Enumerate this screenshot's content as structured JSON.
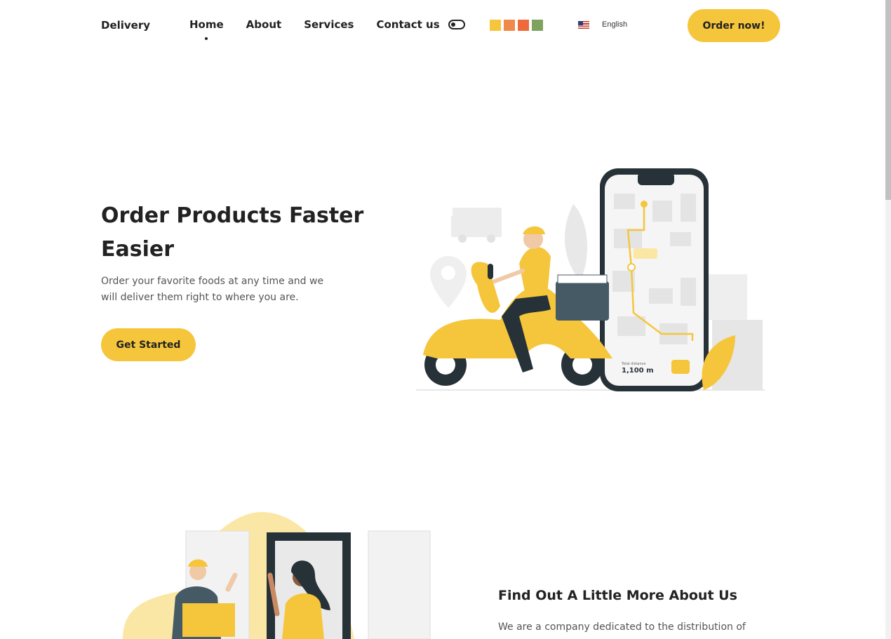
{
  "header": {
    "brand": "Delivery",
    "nav": [
      {
        "label": "Home",
        "active": true
      },
      {
        "label": "About"
      },
      {
        "label": "Services"
      },
      {
        "label": "Contact us"
      }
    ],
    "theme_toggle_icon": "toggle-icon",
    "color_swatches": [
      "#f5c63c",
      "#f08a4b",
      "#ee6a3a",
      "#7ea35e"
    ],
    "language": {
      "flag_icon": "us-flag-icon",
      "label": "English"
    },
    "order_button": "Order now!"
  },
  "hero": {
    "title": "Order Products Faster Easier",
    "description": "Order your favorite foods at any time and we will deliver them right to where you are.",
    "cta": "Get Started",
    "illustration": {
      "distance_label": "Total distance",
      "distance_value": "1,100 m"
    }
  },
  "about": {
    "title": "Find Out A Little More About Us",
    "description": "We are a company dedicated to the distribution of"
  },
  "colors": {
    "accent": "#f5c63c",
    "dark": "#263238",
    "text": "#222222"
  }
}
